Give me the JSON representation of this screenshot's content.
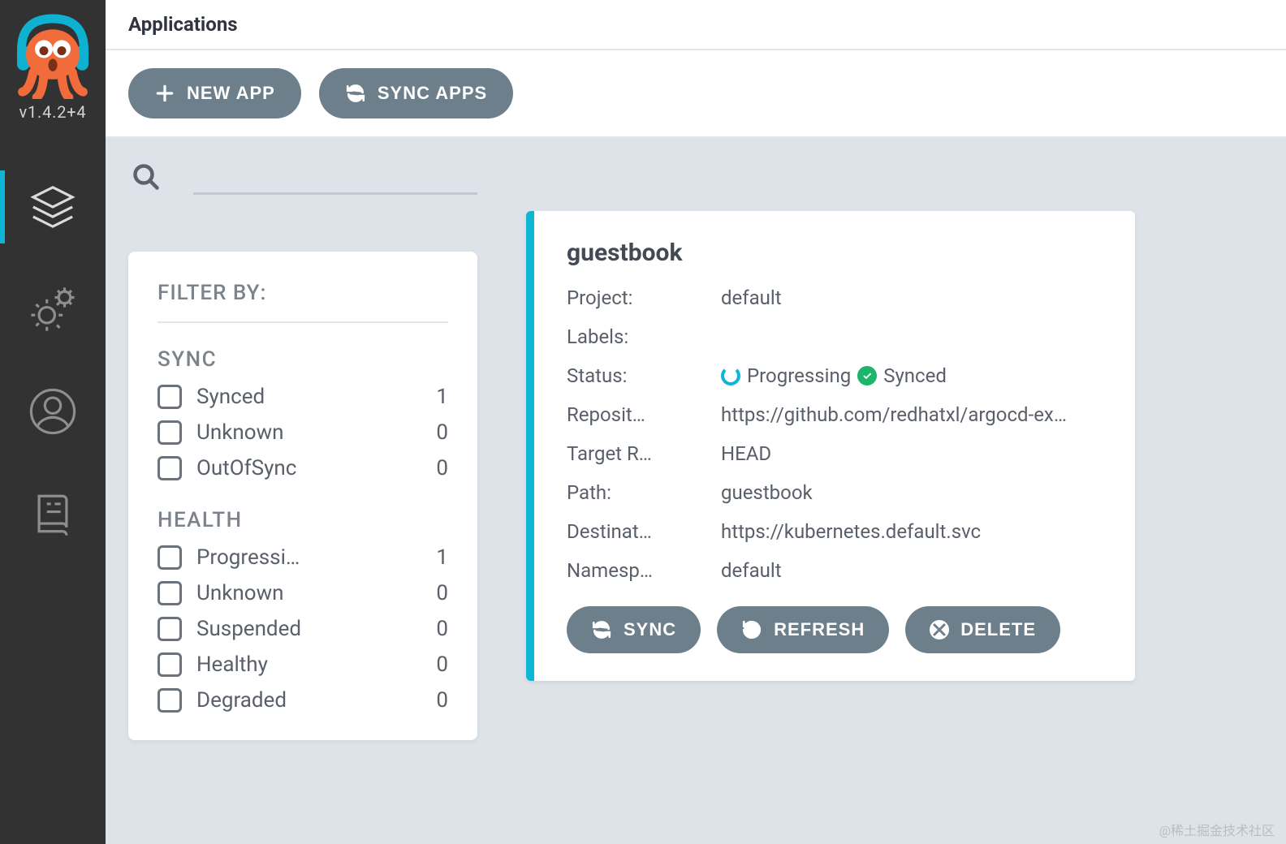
{
  "sidebar": {
    "version": "v1.4.2+4"
  },
  "header": {
    "title": "Applications"
  },
  "toolbar": {
    "new_app_label": "NEW APP",
    "sync_apps_label": "SYNC APPS"
  },
  "filter": {
    "heading": "FILTER BY:",
    "groups": [
      {
        "title": "SYNC",
        "items": [
          {
            "label": "Synced",
            "count": 1
          },
          {
            "label": "Unknown",
            "count": 0
          },
          {
            "label": "OutOfSync",
            "count": 0
          }
        ]
      },
      {
        "title": "HEALTH",
        "items": [
          {
            "label": "Progressi…",
            "count": 1
          },
          {
            "label": "Unknown",
            "count": 0
          },
          {
            "label": "Suspended",
            "count": 0
          },
          {
            "label": "Healthy",
            "count": 0
          },
          {
            "label": "Degraded",
            "count": 0
          }
        ]
      }
    ]
  },
  "app_card": {
    "title": "guestbook",
    "rows": {
      "project_label": "Project:",
      "project_value": "default",
      "labels_label": "Labels:",
      "labels_value": "",
      "status_label": "Status:",
      "status_progressing": "Progressing",
      "status_synced": "Synced",
      "repo_label": "Reposit…",
      "repo_value": "https://github.com/redhatxl/argocd-ex…",
      "target_label": "Target R…",
      "target_value": "HEAD",
      "path_label": "Path:",
      "path_value": "guestbook",
      "dest_label": "Destinat…",
      "dest_value": "https://kubernetes.default.svc",
      "ns_label": "Namesp…",
      "ns_value": "default"
    },
    "actions": {
      "sync": "SYNC",
      "refresh": "REFRESH",
      "delete": "DELETE"
    }
  },
  "watermark": "@稀土掘金技术社区"
}
